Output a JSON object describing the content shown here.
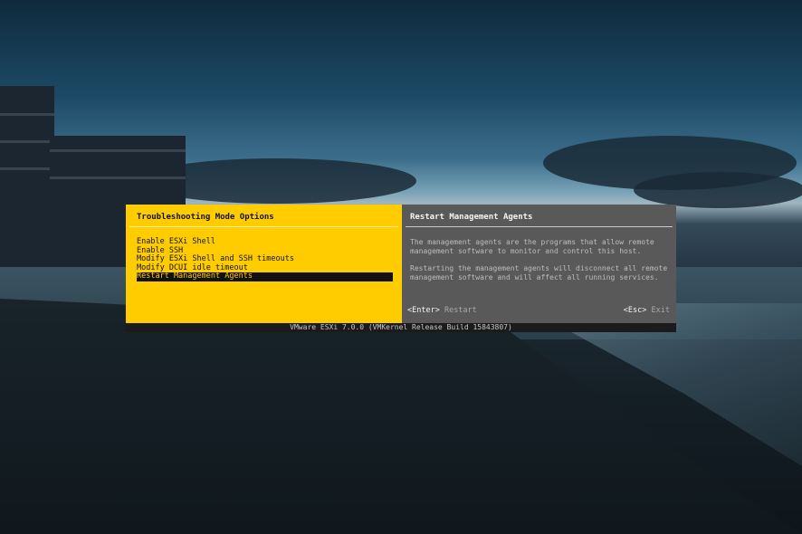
{
  "left_pane": {
    "title": "Troubleshooting Mode Options",
    "menu_items": [
      "Enable ESXi Shell",
      "Enable SSH",
      "Modify ESXi Shell and SSH timeouts",
      "Modify DCUI idle timeout",
      "Restart Management Agents"
    ],
    "selected_index": 4
  },
  "right_pane": {
    "title": "Restart Management Agents",
    "paragraph_1": "The management agents are the programs that allow remote\nmanagement software to monitor and control this host.",
    "paragraph_2": "Restarting the management agents will disconnect all remote\nmanagement software and will affect all running services.",
    "enter_key": "<Enter>",
    "enter_action": "Restart",
    "esc_key": "<Esc>",
    "esc_action": "Exit"
  },
  "status_bar": {
    "text": "VMware ESXi 7.0.0 (VMKernel Release Build 15843807)"
  },
  "colors": {
    "accent_yellow": "#ffcc00",
    "panel_gray": "#595959",
    "selection_black": "#111111"
  }
}
